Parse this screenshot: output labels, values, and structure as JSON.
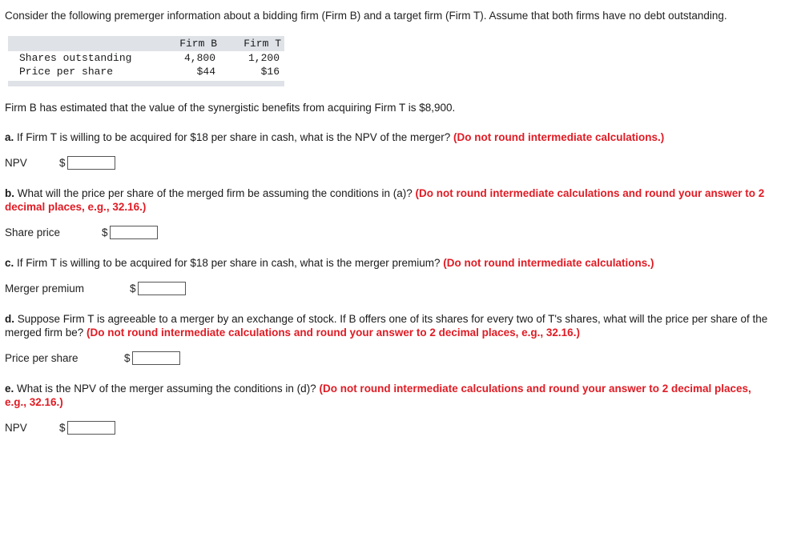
{
  "intro": "Consider the following premerger information about a bidding firm (Firm B) and a target firm (Firm T). Assume that both firms have no debt outstanding.",
  "table": {
    "columns": [
      "",
      "Firm B",
      "Firm T"
    ],
    "rows": [
      {
        "label": "Shares outstanding",
        "firm_b": "4,800",
        "firm_t": "1,200"
      },
      {
        "label": "Price per share",
        "firm_b": "$44",
        "firm_t": "$16"
      }
    ]
  },
  "synergy_statement": "Firm B has estimated that the value of the synergistic benefits from acquiring Firm T is $8,900.",
  "questions": [
    {
      "id": "a",
      "marker": "a.",
      "text": " If Firm T is willing to be acquired for $18 per share in cash, what is the NPV of the merger? ",
      "note": "(Do not round intermediate calculations.)",
      "answer_label": "NPV",
      "currency": "$",
      "answer_value": ""
    },
    {
      "id": "b",
      "marker": "b.",
      "text": " What will the price per share of the merged firm be assuming the conditions in (a)? ",
      "note": "(Do not round intermediate calculations and round your answer to 2 decimal places, e.g., 32.16.)",
      "answer_label": "Share price",
      "currency": "$",
      "answer_value": ""
    },
    {
      "id": "c",
      "marker": "c.",
      "text": " If Firm T is willing to be acquired for $18 per share in cash, what is the merger premium? ",
      "note": "(Do not round intermediate calculations.)",
      "answer_label": "Merger premium",
      "currency": "$",
      "answer_value": ""
    },
    {
      "id": "d",
      "marker": "d.",
      "text": " Suppose Firm T is agreeable to a merger by an exchange of stock. If B offers one of its shares for every two of T's shares, what will the price per share of the merged firm be? ",
      "note": "(Do not round intermediate calculations and round your answer to 2 decimal places, e.g., 32.16.)",
      "answer_label": "Price per share",
      "currency": "$",
      "answer_value": ""
    },
    {
      "id": "e",
      "marker": "e.",
      "text": " What is the NPV of the merger assuming the conditions in (d)? ",
      "note": "(Do not round intermediate calculations and round your answer to 2 decimal places, e.g., 32.16.)",
      "answer_label": "NPV",
      "currency": "$",
      "answer_value": ""
    }
  ]
}
